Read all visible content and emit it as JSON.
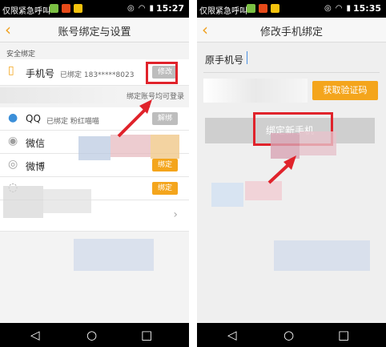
{
  "left": {
    "status": {
      "carrier": "仅限紧急呼叫",
      "time": "15:27"
    },
    "title": "账号绑定与设置",
    "section_label": "安全绑定",
    "rows": [
      {
        "icon": "mobile-phone-icon",
        "name": "手机号",
        "sub": "已绑定 183*****8023",
        "button": "修改"
      },
      {
        "note": "绑定账号均可登录"
      },
      {
        "icon": "qq-icon",
        "name": "QQ",
        "sub": "已绑定 粉红喵喵",
        "button": "解绑"
      },
      {
        "icon": "wechat-icon",
        "name": "微信"
      },
      {
        "icon": "weibo-icon",
        "name": "微博",
        "button": "绑定"
      },
      {
        "button": "绑定"
      }
    ]
  },
  "right": {
    "status": {
      "carrier": "仅限紧急呼叫",
      "time": "15:35"
    },
    "title": "修改手机绑定",
    "field_label": "原手机号",
    "verify_button": "获取验证码",
    "bind_button": "绑定新手机"
  },
  "colors": {
    "accent": "#f4a51c",
    "highlight": "#e0232b"
  }
}
